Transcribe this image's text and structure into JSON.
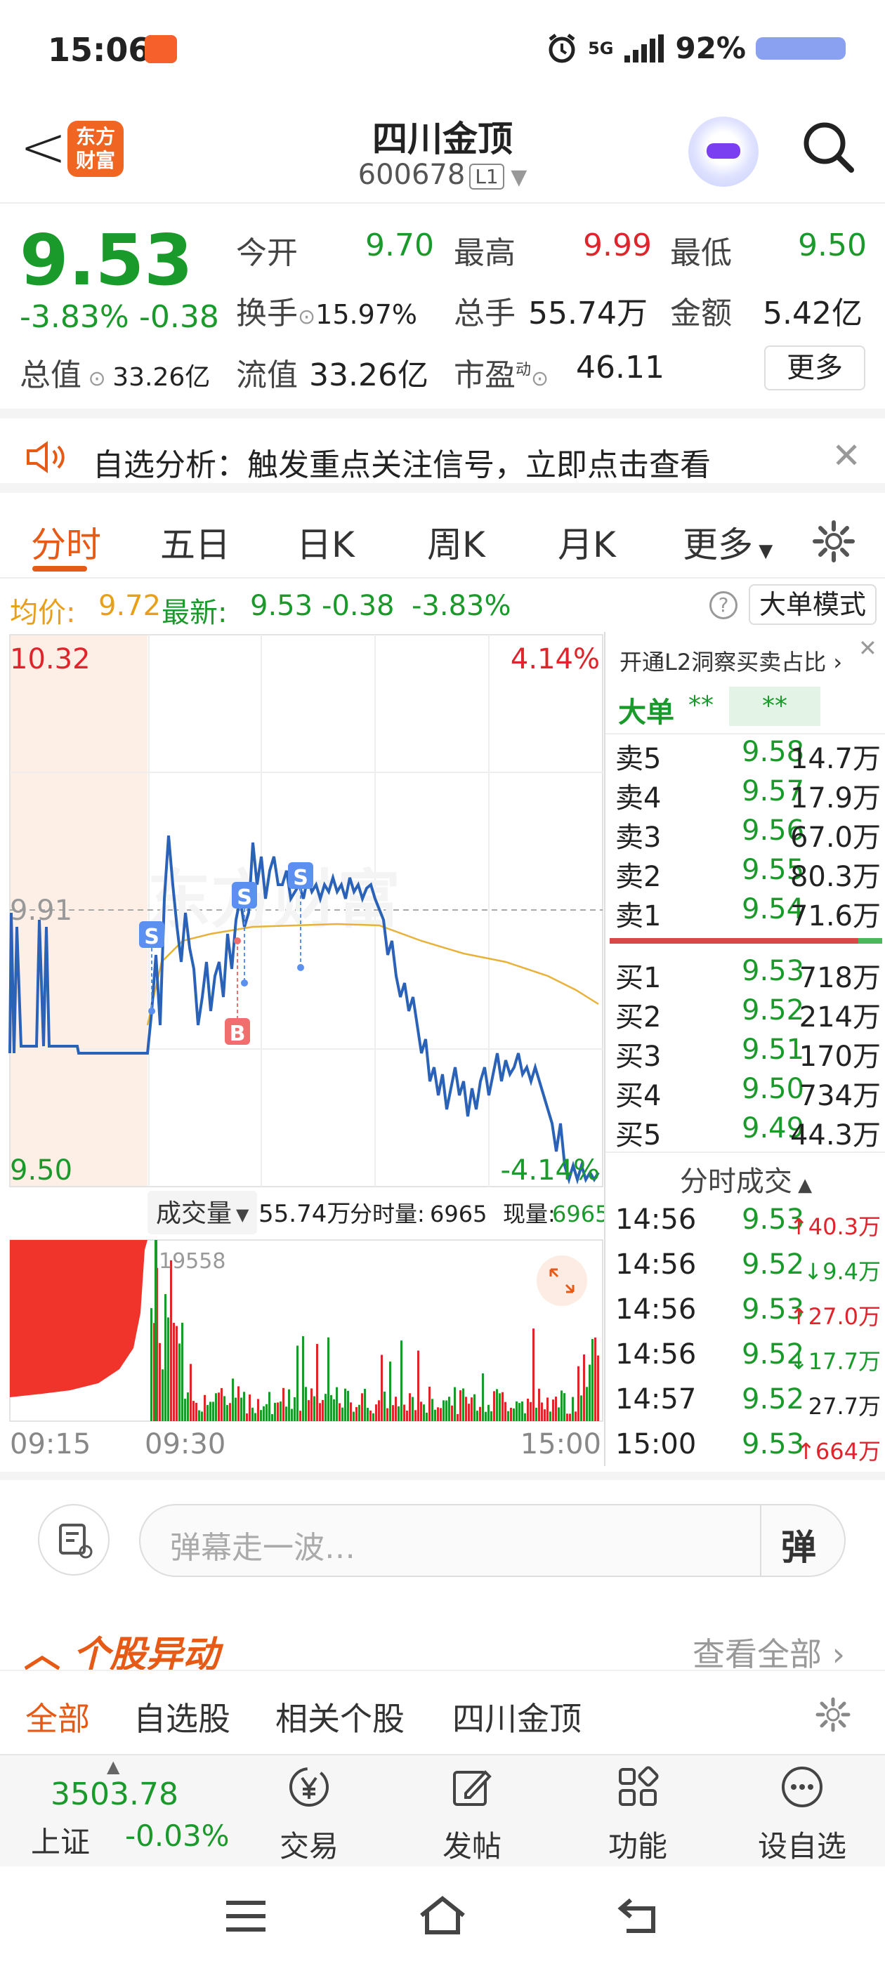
{
  "status": {
    "time": "15:06",
    "network": "5G",
    "battery": "92%"
  },
  "header": {
    "logo_text": "东方财富",
    "title": "四川金顶",
    "code": "600678",
    "level_badge": "L1"
  },
  "quote": {
    "price": "9.53",
    "change_pct": "-3.83%",
    "change": "-0.38",
    "open_label": "今开",
    "open": "9.70",
    "high_label": "最高",
    "high": "9.99",
    "low_label": "最低",
    "low": "9.50",
    "turnover_label": "换手",
    "turnover": "15.97%",
    "volume_label": "总手",
    "volume": "55.74万",
    "amount_label": "金额",
    "amount": "5.42亿",
    "mktcap_label": "总值",
    "mktcap": "33.26亿",
    "float_label": "流值",
    "float": "33.26亿",
    "pe_label": "市盈",
    "pe_super": "动",
    "pe": "46.11",
    "more_label": "更多"
  },
  "banner": {
    "text": "自选分析：触发重点关注信号，立即点击查看"
  },
  "tabs": [
    {
      "label": "分时"
    },
    {
      "label": "五日"
    },
    {
      "label": "日K"
    },
    {
      "label": "周K"
    },
    {
      "label": "月K"
    },
    {
      "label": "更多"
    }
  ],
  "inforow": {
    "avg_label": "均价:",
    "avg": "9.72",
    "latest_label": "最新:",
    "latest": "9.53",
    "chg": "-0.38",
    "chg_pct": "-3.83%",
    "help": "?",
    "mode_button": "大单模式"
  },
  "chart": {
    "price_top": "10.32",
    "price_mid": "9.91",
    "price_bottom": "9.50",
    "pct_top": "4.14%",
    "pct_bottom": "-4.14%",
    "watermark": "东方财富",
    "sell_marker": "S",
    "buy_marker": "B",
    "vol_selector": "成交量",
    "vol_total": "55.74万",
    "vol_time_label": "分时量:",
    "vol_time": "6965",
    "vol_now_label": "现量:",
    "vol_now": "6965",
    "vol_peak": "19558",
    "time_start": "09:15",
    "time_open": "09:30",
    "time_end": "15:00"
  },
  "orderbook": {
    "l2_text": "开通L2洞察买卖占比",
    "big_order_label": "大单",
    "big_order_mask1": "**",
    "big_order_mask2": "**",
    "asks": [
      {
        "label": "卖5",
        "price": "9.58",
        "vol": "14.7万"
      },
      {
        "label": "卖4",
        "price": "9.57",
        "vol": "17.9万"
      },
      {
        "label": "卖3",
        "price": "9.56",
        "vol": "67.0万"
      },
      {
        "label": "卖2",
        "price": "9.55",
        "vol": "80.3万"
      },
      {
        "label": "卖1",
        "price": "9.54",
        "vol": "71.6万"
      }
    ],
    "bids": [
      {
        "label": "买1",
        "price": "9.53",
        "vol": "718万"
      },
      {
        "label": "买2",
        "price": "9.52",
        "vol": "214万"
      },
      {
        "label": "买3",
        "price": "9.51",
        "vol": "170万"
      },
      {
        "label": "买4",
        "price": "9.50",
        "vol": "734万"
      },
      {
        "label": "买5",
        "price": "9.49",
        "vol": "44.3万"
      }
    ],
    "ticks_header": "分时成交",
    "ticks": [
      {
        "time": "14:56",
        "price": "9.53",
        "dir": "↑",
        "vol": "40.3万",
        "color": "#e0242b"
      },
      {
        "time": "14:56",
        "price": "9.52",
        "dir": "↓",
        "vol": "9.4万",
        "color": "#1b9a2c"
      },
      {
        "time": "14:56",
        "price": "9.53",
        "dir": "↑",
        "vol": "27.0万",
        "color": "#e0242b"
      },
      {
        "time": "14:56",
        "price": "9.52",
        "dir": "↓",
        "vol": "17.7万",
        "color": "#1b9a2c"
      },
      {
        "time": "14:57",
        "price": "9.52",
        "dir": "",
        "vol": "27.7万",
        "color": "#222"
      },
      {
        "time": "15:00",
        "price": "9.53",
        "dir": "↑",
        "vol": "664万",
        "color": "#e0242b"
      }
    ]
  },
  "danmu": {
    "placeholder": "弹幕走一波…",
    "send_label": "弹"
  },
  "news": {
    "section_title": "个股异动",
    "view_all": "查看全部",
    "tabs": [
      {
        "label": "全部"
      },
      {
        "label": "自选股"
      },
      {
        "label": "相关个股"
      },
      {
        "label": "四川金顶"
      }
    ]
  },
  "bottomnav": {
    "index_value": "3503.78",
    "index_name": "上证",
    "index_change": "-0.03%",
    "items": [
      {
        "label": "交易"
      },
      {
        "label": "发帖"
      },
      {
        "label": "功能"
      },
      {
        "label": "设自选"
      }
    ]
  },
  "colors": {
    "up": "#e0242b",
    "down": "#1b9a2c",
    "accent": "#e65a16",
    "avg_line": "#e8b23a",
    "price_line": "#2a62b8"
  }
}
